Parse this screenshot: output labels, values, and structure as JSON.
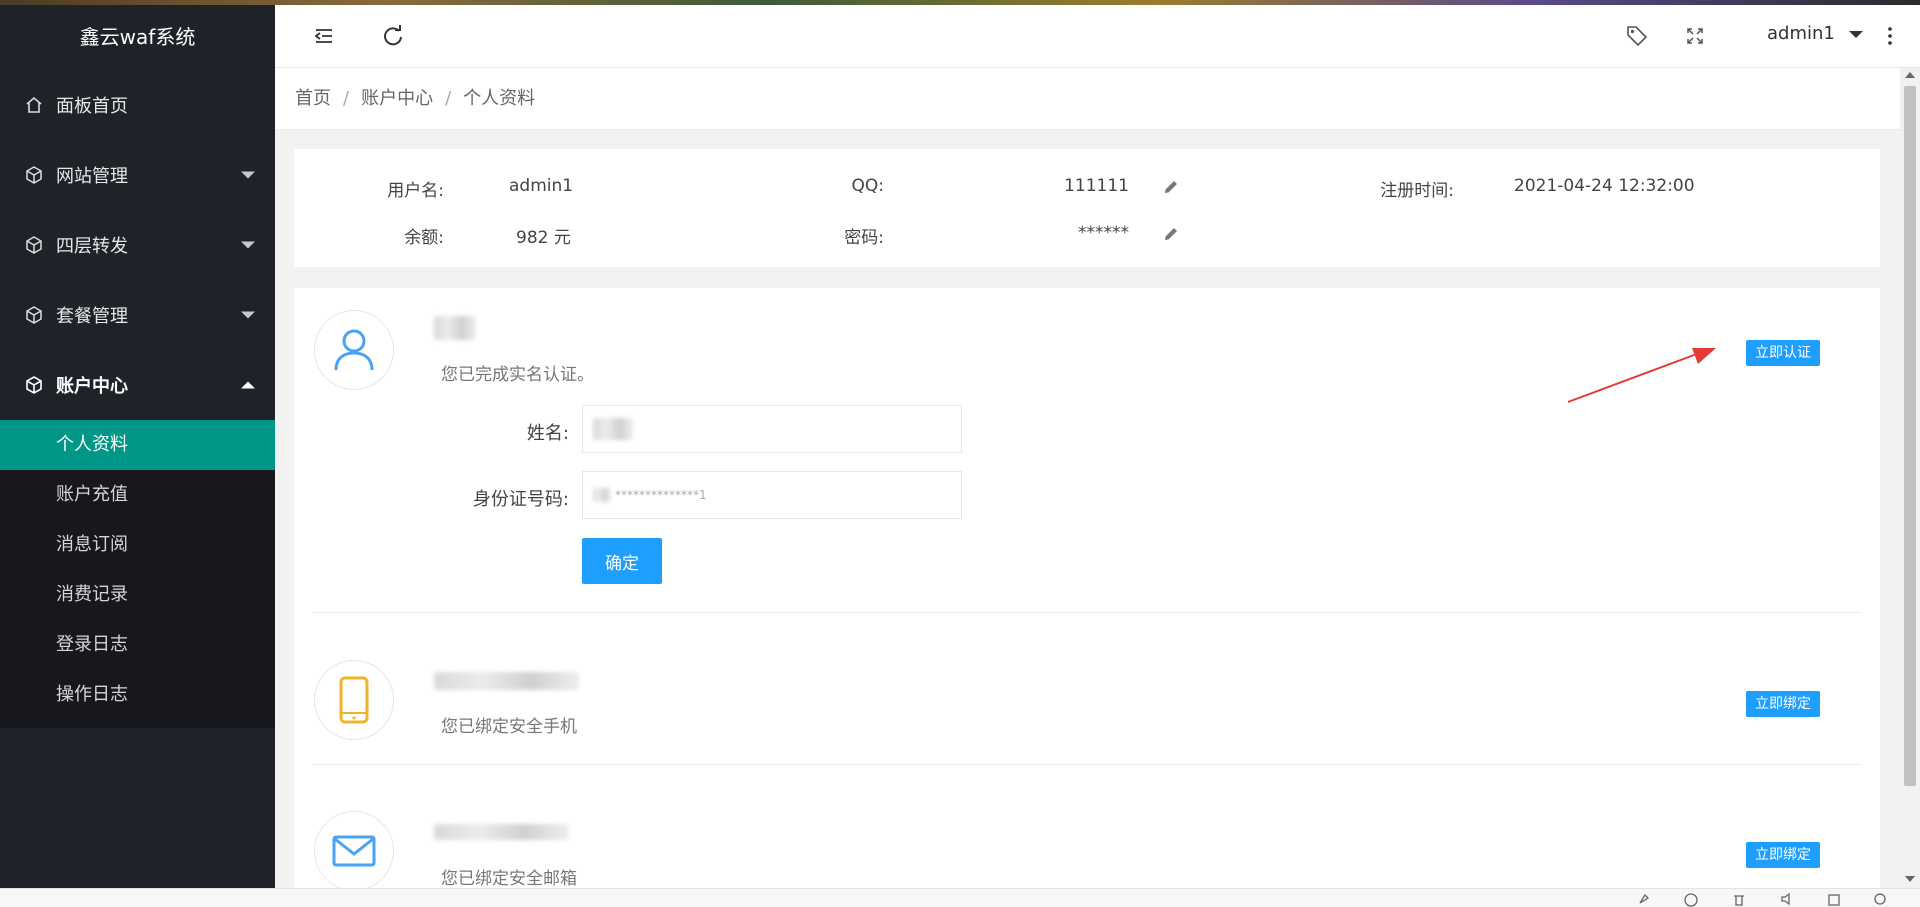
{
  "app": {
    "title": "鑫云waf系统"
  },
  "sidebar": {
    "items": [
      {
        "label": "面板首页",
        "icon": "home-icon",
        "has_caret": false
      },
      {
        "label": "网站管理",
        "icon": "cube-icon",
        "has_caret": true
      },
      {
        "label": "四层转发",
        "icon": "cube-icon",
        "has_caret": true
      },
      {
        "label": "套餐管理",
        "icon": "cube-icon",
        "has_caret": true
      },
      {
        "label": "账户中心",
        "icon": "cube-icon",
        "has_caret": true,
        "expanded": true
      }
    ],
    "submenu": [
      {
        "label": "个人资料",
        "active": true
      },
      {
        "label": "账户充值"
      },
      {
        "label": "消息订阅"
      },
      {
        "label": "消费记录"
      },
      {
        "label": "登录日志"
      },
      {
        "label": "操作日志"
      }
    ]
  },
  "header": {
    "username": "admin1",
    "icons": [
      "menu-fold-icon",
      "refresh-icon",
      "tag-icon",
      "fullscreen-icon",
      "more-vertical-icon"
    ]
  },
  "breadcrumb": {
    "home": "首页",
    "parent": "账户中心",
    "current": "个人资料",
    "separator": "/"
  },
  "profile": {
    "username_label": "用户名:",
    "username": "admin1",
    "qq_label": "QQ:",
    "qq": "111111",
    "register_label": "注册时间:",
    "register_time": "2021-04-24 12:32:00",
    "balance_label": "余额:",
    "balance": "982 元",
    "password_label": "密码:",
    "password": "******"
  },
  "verify": {
    "desc": "您已完成实名认证。",
    "button": "立即认证",
    "name_label": "姓名:",
    "id_label": "身份证号码:",
    "id_value": "**************1",
    "confirm": "确定"
  },
  "phone": {
    "desc": "您已绑定安全手机",
    "button": "立即绑定"
  },
  "email": {
    "desc": "您已绑定安全邮箱",
    "button": "立即绑定"
  },
  "colors": {
    "accent": "#1e9fff",
    "active_menu": "#009688",
    "sidebar_bg": "#20222a",
    "arrow": "#e53935"
  }
}
